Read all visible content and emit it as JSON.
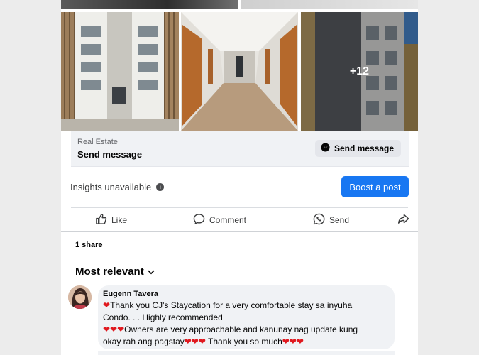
{
  "listing": {
    "more_photos": "+12",
    "category": "Real Estate",
    "cta_title": "Send message",
    "cta_button": "Send message"
  },
  "insights": {
    "label": "Insights unavailable",
    "boost_label": "Boost a post"
  },
  "actions": {
    "like": "Like",
    "comment": "Comment",
    "send": "Send"
  },
  "shares": "1 share",
  "comments_filter": "Most relevant",
  "comment": {
    "author": "Eugenn Tavera",
    "line1": "Thank you CJ's Staycation for a very comfortable stay sa inyuha",
    "line2": "Condo. . . Highly recommended",
    "line3": "Owners are very approachable and kanunay nag update kung",
    "line4": "okay rah ang pagstay",
    "line4b": " Thank you so much"
  },
  "colors": {
    "accent": "#1877f2",
    "heart": "#e0181e"
  }
}
